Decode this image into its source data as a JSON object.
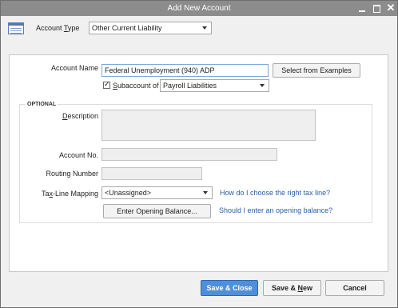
{
  "window": {
    "title": "Add New Account"
  },
  "account_type": {
    "label_pre": "Account ",
    "label_key": "T",
    "label_post": "ype",
    "value": "Other Current Liability"
  },
  "account_name": {
    "label": "Account Name",
    "value": "Federal Unemployment (940) ADP"
  },
  "select_examples_label": "Select from Examples",
  "subaccount": {
    "checked": true,
    "label_key": "S",
    "label_post": "ubaccount of",
    "value": "Payroll Liabilities"
  },
  "optional_title": "OPTIONAL",
  "description": {
    "label_key": "D",
    "label_post": "escription",
    "value": ""
  },
  "account_no": {
    "label": "Account No.",
    "value": ""
  },
  "routing_number": {
    "label": "Routing Number",
    "value": ""
  },
  "tax_line": {
    "label_pre": "Ta",
    "label_key": "x",
    "label_post": "-Line Mapping",
    "value": "<Unassigned>",
    "help_link": "How do I choose the right tax line?"
  },
  "opening_balance": {
    "button_label": "Enter Opening Balance...",
    "help_link": "Should I enter an opening balance?"
  },
  "footer": {
    "save_close": "Save & Close",
    "save_new_pre": "Save & ",
    "save_new_key": "N",
    "save_new_post": "ew",
    "cancel": "Cancel"
  },
  "colors": {
    "title_bar": "#8c8c8c",
    "primary_button": "#4f8fd9",
    "link": "#2a5ea8"
  }
}
